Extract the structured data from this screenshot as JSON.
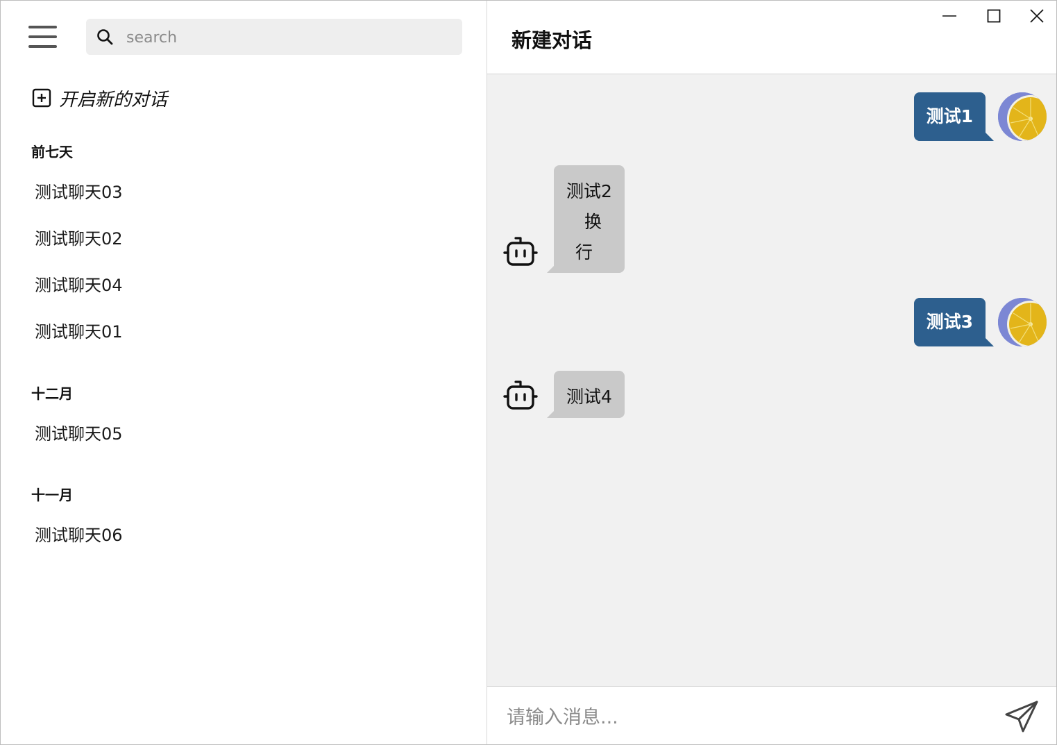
{
  "sidebar": {
    "search_placeholder": "search",
    "new_chat_label": "开启新的对话",
    "groups": [
      {
        "title": "前七天",
        "items": [
          "测试聊天03",
          "测试聊天02",
          "测试聊天04",
          "测试聊天01"
        ]
      },
      {
        "title": "十二月",
        "items": [
          "测试聊天05"
        ]
      },
      {
        "title": "十一月",
        "items": [
          "测试聊天06"
        ]
      }
    ]
  },
  "header": {
    "title": "新建对话"
  },
  "messages": [
    {
      "role": "user",
      "text": "测试1"
    },
    {
      "role": "bot",
      "lines": [
        "测试2",
        "换",
        "行"
      ]
    },
    {
      "role": "user",
      "text": "测试3"
    },
    {
      "role": "bot",
      "lines": [
        "测试4"
      ]
    }
  ],
  "composer": {
    "placeholder": "请输入消息..."
  },
  "colors": {
    "user_bubble": "#2d5f8e",
    "bot_bubble": "#c9c9c9",
    "chat_background": "#f1f1f1",
    "search_background": "#eeeeee"
  },
  "icons": {
    "menu": "hamburger-icon",
    "search": "search-icon",
    "new_chat": "plus-square-icon",
    "bot": "robot-icon",
    "send": "paper-plane-icon",
    "minimize": "minimize-icon",
    "maximize": "maximize-icon",
    "close": "close-icon"
  }
}
